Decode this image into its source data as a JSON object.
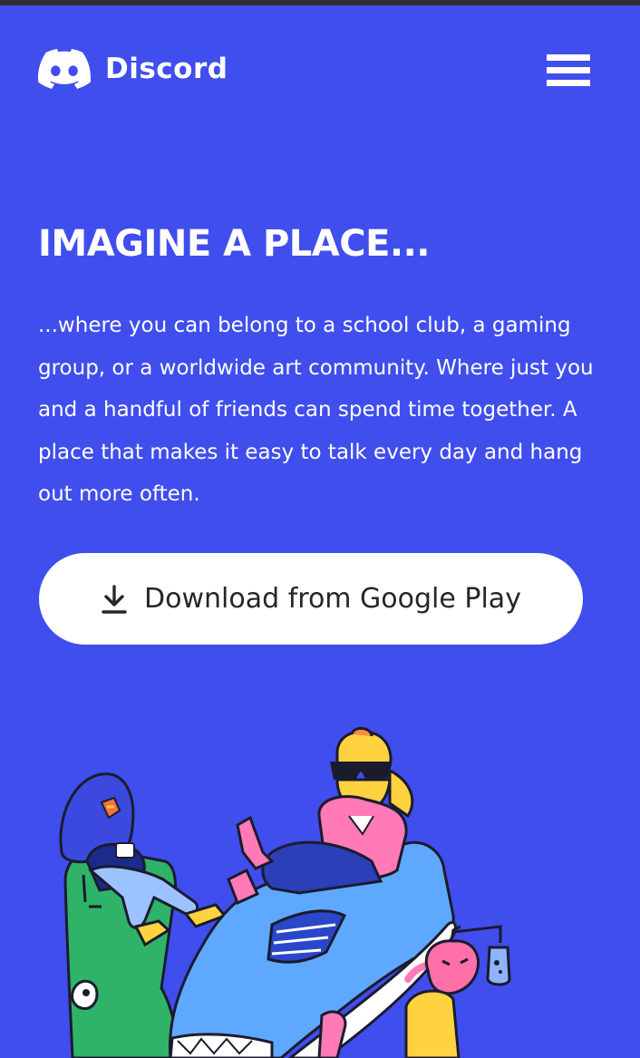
{
  "header": {
    "brand_name": "Discord",
    "logo_icon": "discord-clyde-icon",
    "menu_icon": "hamburger-menu-icon"
  },
  "hero": {
    "headline": "IMAGINE A PLACE...",
    "description": "...where you can belong to a school club, a gaming group, or a worldwide art community. Where just you and a handful of friends can spend time together. A place that makes it easy to talk every day and hang out more often.",
    "download_label": "Download from Google Play",
    "download_icon": "download-icon"
  },
  "colors": {
    "background": "#404EED",
    "button_background": "#FFFFFF",
    "button_text": "#23272A",
    "text": "#FFFFFF"
  }
}
